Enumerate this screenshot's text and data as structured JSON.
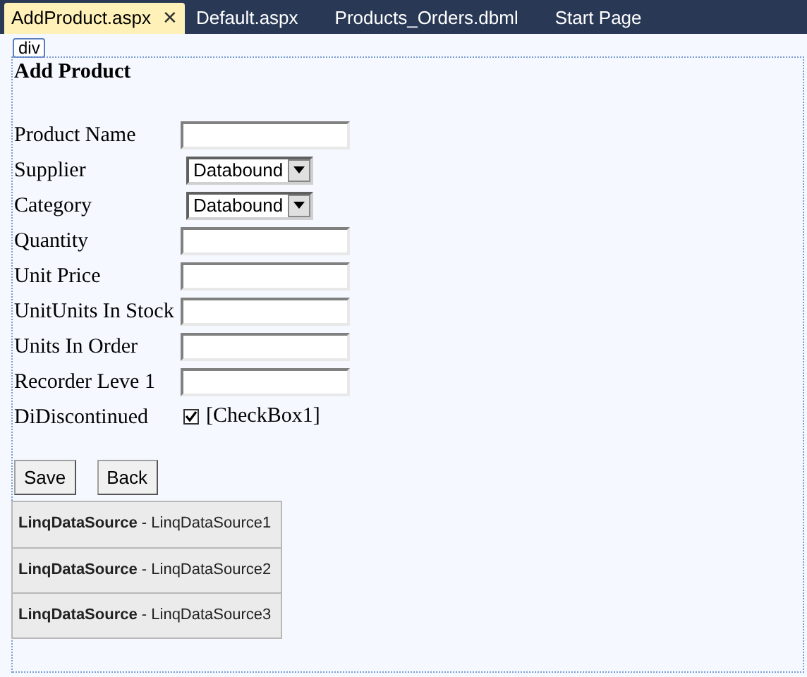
{
  "tabs": [
    {
      "label": "AddProduct.aspx",
      "selected": true,
      "close": "✕"
    },
    {
      "label": "Default.aspx",
      "selected": false
    },
    {
      "label": "Products_Orders.dbml",
      "selected": false
    },
    {
      "label": "Start Page",
      "selected": false
    }
  ],
  "tag": "div",
  "heading": "Add Product",
  "fields": [
    {
      "label": "Product Name",
      "kind": "text"
    },
    {
      "label": "Supplier",
      "kind": "select",
      "value": "Databound"
    },
    {
      "label": "Category",
      "kind": "select",
      "value": "Databound"
    },
    {
      "label": "Quantity",
      "kind": "text"
    },
    {
      "label": "Unit Price",
      "kind": "text"
    },
    {
      "label": "UnitUnits In Stock",
      "kind": "text"
    },
    {
      "label": "Units In Order",
      "kind": "text"
    },
    {
      "label": "Recorder Leve 1",
      "kind": "text"
    },
    {
      "label": "DiDiscontinued",
      "kind": "checkbox",
      "checked": true,
      "text": "[CheckBox1]"
    }
  ],
  "buttons": [
    "Save",
    "Back"
  ],
  "data_sources": [
    "**LinqDataSource** - LinqDataSource1",
    "**LinqDataSource** - LinqDataSource2",
    "**LinqDataSource** - LinqDataSource3"
  ]
}
